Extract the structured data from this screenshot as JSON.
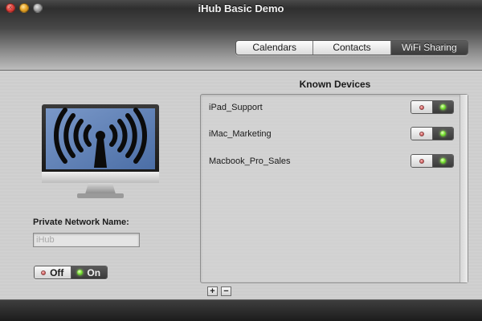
{
  "window": {
    "title": "iHub Basic Demo"
  },
  "tabs": [
    {
      "label": "Calendars",
      "active": false
    },
    {
      "label": "Contacts",
      "active": false
    },
    {
      "label": "WiFi Sharing",
      "active": true
    }
  ],
  "left_panel": {
    "icon": "imac-wifi-icon",
    "network_label": "Private Network Name:",
    "network_placeholder": "iHub",
    "network_value": "",
    "toggle": {
      "off_label": "Off",
      "on_label": "On",
      "state": "on"
    }
  },
  "known_devices": {
    "title": "Known Devices",
    "devices": [
      {
        "name": "iPad_Support",
        "state": "on"
      },
      {
        "name": "iMac_Marketing",
        "state": "on"
      },
      {
        "name": "Macbook_Pro_Sales",
        "state": "on"
      }
    ],
    "add_label": "+",
    "remove_label": "−"
  },
  "colors": {
    "led_on": "#7ee23a",
    "led_off": "#d86a6a",
    "screen_blue": "#5f7fb0"
  }
}
